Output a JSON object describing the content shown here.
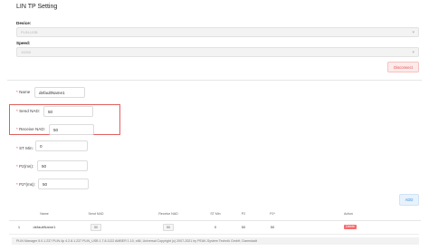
{
  "page": {
    "title": "LIN TP Setting"
  },
  "device": {
    "label": "Device:",
    "value": "PLIN-USB"
  },
  "speed": {
    "label": "Speed:",
    "value": "19200"
  },
  "disconnect_label": "Disconnect",
  "form": {
    "name": {
      "label": "Name",
      "value": "defaultName1"
    },
    "send_nad": {
      "label": "Send NAD:",
      "value": "50"
    },
    "receive_nad": {
      "label": "Receive NAD:",
      "value": "50"
    },
    "st_min": {
      "label": "ST Min:",
      "value": "0"
    },
    "p2": {
      "label": "P2(ms):",
      "value": "50"
    },
    "p2star": {
      "label": "P2*(ms):",
      "value": "50"
    },
    "required_mark": "*"
  },
  "add_label": "ADD",
  "table": {
    "headers": [
      "",
      "Name",
      "Send NAD",
      "Receive NAD",
      "ST Min",
      "P2",
      "P2*",
      "Action"
    ],
    "rows": [
      {
        "index": "1",
        "name": "defaultName1",
        "send_nad": "50",
        "receive_nad": "50",
        "st_min": "0",
        "p2": "50",
        "p2star": "50",
        "action": "Delete"
      }
    ]
  },
  "footer": "PLIN Manager 5.0.1.237 PLIN.4p 4.2.8.1.237 PLIN_USB 1.7.8.1122 AMBER 1.10, x86, Universal Copyright (c) 2007-2021 by PEAK-System Technik GmbH, Darmstadt"
}
